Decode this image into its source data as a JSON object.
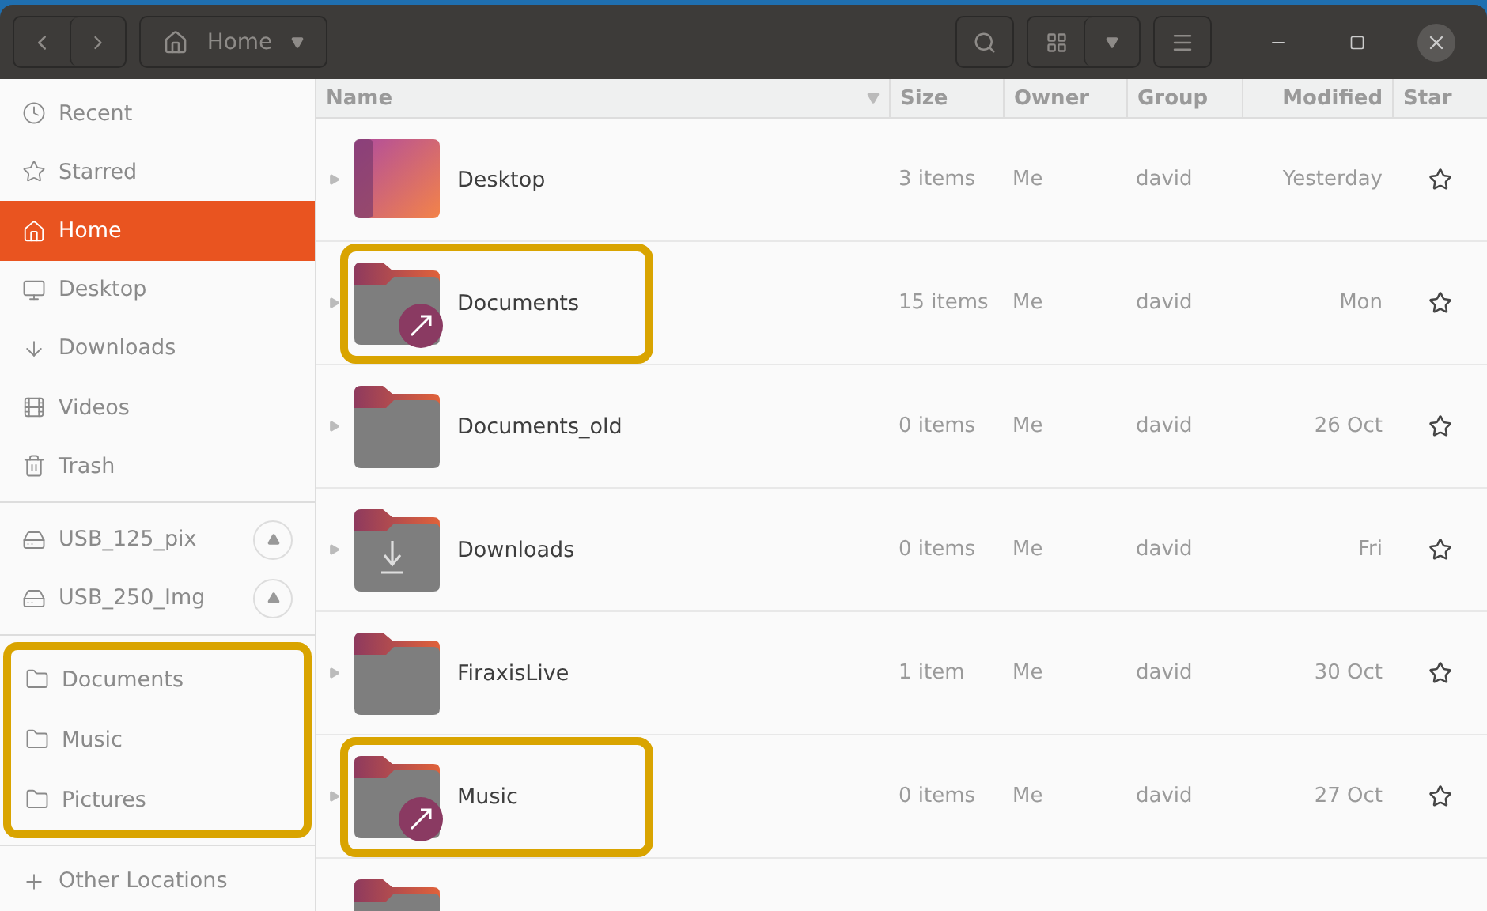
{
  "window": {
    "location": "Home"
  },
  "sidebar": {
    "places": [
      {
        "label": "Recent",
        "kind": "clock",
        "selected": false
      },
      {
        "label": "Starred",
        "kind": "star",
        "selected": false
      },
      {
        "label": "Home",
        "kind": "home",
        "selected": true
      },
      {
        "label": "Desktop",
        "kind": "desktop",
        "selected": false
      },
      {
        "label": "Downloads",
        "kind": "download",
        "selected": false
      },
      {
        "label": "Videos",
        "kind": "video",
        "selected": false
      },
      {
        "label": "Trash",
        "kind": "trash",
        "selected": false
      }
    ],
    "devices": [
      {
        "label": "USB_125_pix"
      },
      {
        "label": "USB_250_Img"
      }
    ],
    "bookmarks": {
      "highlighted": true,
      "items": [
        {
          "label": "Documents"
        },
        {
          "label": "Music"
        },
        {
          "label": "Pictures"
        }
      ]
    },
    "other": {
      "label": "Other Locations"
    }
  },
  "table": {
    "columns": [
      "Name",
      "Size",
      "Owner",
      "Group",
      "Modified",
      "Star"
    ],
    "rows": [
      {
        "kind": "desktop",
        "name": "Desktop",
        "size": "3 items",
        "owner": "Me",
        "group": "david",
        "modified": "Yesterday",
        "highlighted": false
      },
      {
        "kind": "link",
        "name": "Documents",
        "size": "15 items",
        "owner": "Me",
        "group": "david",
        "modified": "Mon",
        "highlighted": true
      },
      {
        "kind": "folder",
        "name": "Documents_old",
        "size": "0 items",
        "owner": "Me",
        "group": "david",
        "modified": "26 Oct",
        "highlighted": false
      },
      {
        "kind": "download",
        "name": "Downloads",
        "size": "0 items",
        "owner": "Me",
        "group": "david",
        "modified": "Fri",
        "highlighted": false
      },
      {
        "kind": "folder",
        "name": "FiraxisLive",
        "size": "1 item",
        "owner": "Me",
        "group": "david",
        "modified": "30 Oct",
        "highlighted": false
      },
      {
        "kind": "link",
        "name": "Music",
        "size": "0 items",
        "owner": "Me",
        "group": "david",
        "modified": "27 Oct",
        "highlighted": true
      },
      {
        "kind": "folder",
        "highlighted": false
      }
    ]
  }
}
